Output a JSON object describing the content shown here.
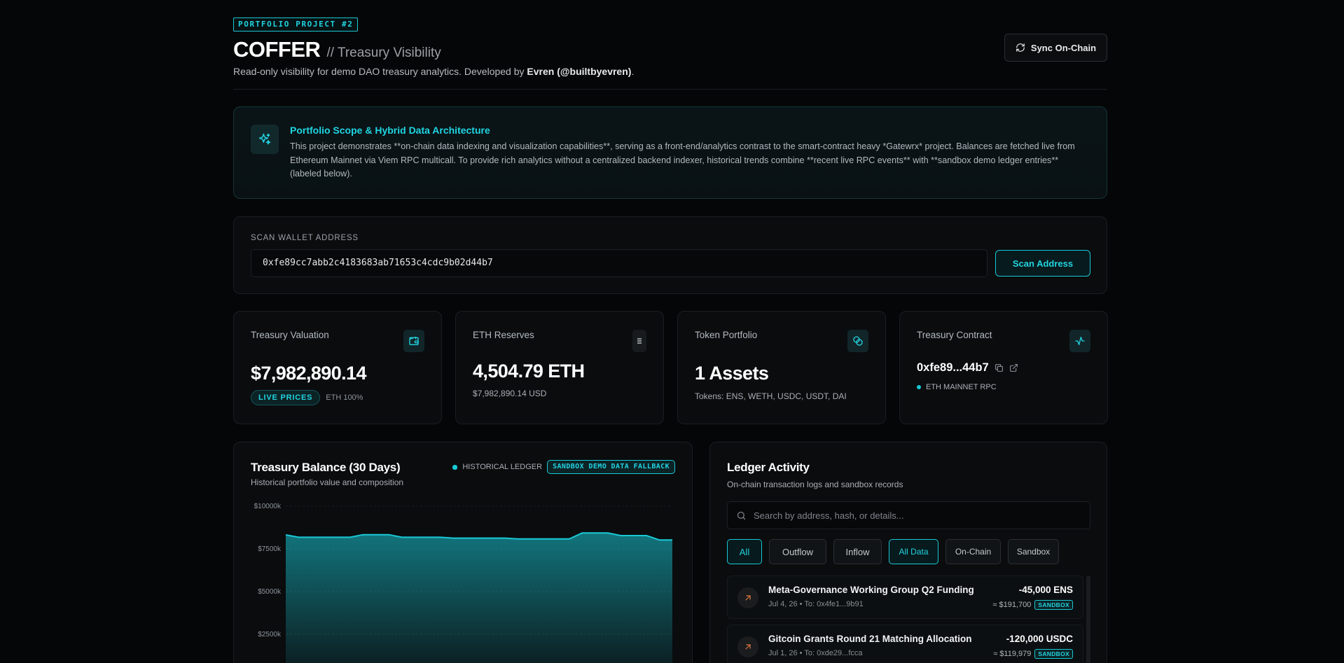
{
  "header": {
    "tag": "PORTFOLIO PROJECT #2",
    "brand": "COFFER",
    "subtitle": "// Treasury Visibility",
    "desc_prefix": "Read-only visibility for demo DAO treasury analytics. Developed by ",
    "desc_author": "Evren (@builtbyevren)",
    "desc_suffix": ".",
    "sync_label": "Sync On-Chain"
  },
  "scope": {
    "title": "Portfolio Scope & Hybrid Data Architecture",
    "body": "This project demonstrates **on-chain data indexing and visualization capabilities**, serving as a front-end/analytics contrast to the smart-contract heavy *Gatewrx* project. Balances are fetched live from Ethereum Mainnet via Viem RPC multicall. To provide rich analytics without a centralized backend indexer, historical trends combine **recent live RPC events** with **sandbox demo ledger entries** (labeled below)."
  },
  "scan": {
    "label": "SCAN WALLET ADDRESS",
    "value": "0xfe89cc7abb2c4183683ab71653c4cdc9b02d44b7",
    "button": "Scan Address"
  },
  "cards": {
    "valuation": {
      "title": "Treasury Valuation",
      "value": "$7,982,890.14",
      "pill": "LIVE PRICES",
      "note": "ETH 100%",
      "icon": "wallet-icon"
    },
    "eth": {
      "title": "ETH Reserves",
      "value": "4,504.79 ETH",
      "note": "$7,982,890.14 USD",
      "icon": "ethereum-icon"
    },
    "tokens": {
      "title": "Token Portfolio",
      "value": "1 Assets",
      "note": "Tokens: ENS, WETH, USDC, USDT, DAI",
      "icon": "coins-icon"
    },
    "contract": {
      "title": "Treasury Contract",
      "value": "0xfe89...44b7",
      "note": "ETH MAINNET RPC",
      "icon": "activity-icon"
    }
  },
  "chart_card": {
    "title": "Treasury Balance (30 Days)",
    "subtitle": "Historical portfolio value and composition",
    "legend_label": "HISTORICAL LEDGER",
    "badge": "SANDBOX DEMO DATA FALLBACK"
  },
  "chart_data": {
    "type": "area",
    "ytick_labels": [
      "$10000k",
      "$7500k",
      "$5000k",
      "$2500k"
    ],
    "yticks": [
      10000,
      7500,
      5000,
      2500
    ],
    "ylim": [
      0,
      10000
    ],
    "values": [
      8320,
      8180,
      8180,
      8180,
      8180,
      8180,
      8330,
      8330,
      8330,
      8180,
      8180,
      8180,
      8180,
      8130,
      8130,
      8130,
      8130,
      8130,
      8080,
      8080,
      8080,
      8080,
      8080,
      8430,
      8430,
      8430,
      8280,
      8280,
      8280,
      8020,
      8020
    ],
    "color": "#19c9d6",
    "grid": true
  },
  "ledger": {
    "title": "Ledger Activity",
    "subtitle": "On-chain transaction logs and sandbox records",
    "search_placeholder": "Search by address, hash, or details...",
    "filters_direction": [
      "All",
      "Outflow",
      "Inflow"
    ],
    "filters_source": [
      "All Data",
      "On-Chain",
      "Sandbox"
    ],
    "transactions": [
      {
        "name": "Meta-Governance Working Group Q2 Funding",
        "meta": "Jul 4, 26  •  To: 0x4fe1...9b91",
        "amount": "-45,000 ENS",
        "usd": "≈ $191,700",
        "badge": "SANDBOX"
      },
      {
        "name": "Gitcoin Grants Round 21 Matching Allocation",
        "meta": "Jul 1, 26  •  To: 0xde29...fcca",
        "amount": "-120,000 USDC",
        "usd": "≈ $119,979",
        "badge": "SANDBOX"
      }
    ]
  },
  "colors": {
    "accent": "#19c9d6",
    "background": "#050607",
    "outflow": "#e0793f"
  }
}
